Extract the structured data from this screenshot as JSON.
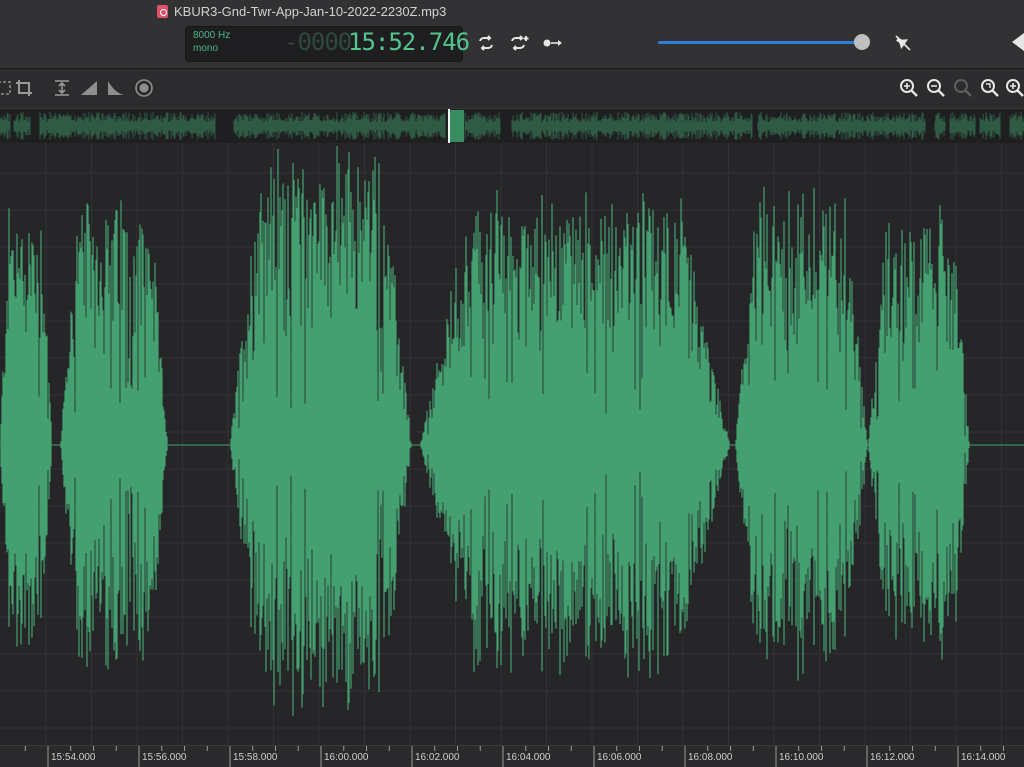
{
  "window": {
    "file_name": "KBUR3-Gnd-Twr-App-Jan-10-2022-2230Z.mp3",
    "file_icon": "audio-file-icon"
  },
  "display": {
    "sample_rate": "8000 Hz",
    "channels": "mono",
    "time_ghost": "-0000",
    "time": "15:52.746"
  },
  "transport": {
    "loop_icon": "loop-icon",
    "loop_selection_icon": "loop-selection-icon",
    "play_from_icon": "play-from-cursor-icon",
    "volume_level": 0.97,
    "volume_icon": "speaker-muted-icon",
    "back_icon": "back-arrow-icon"
  },
  "toolbar": {
    "left_tools": [
      "select-icon",
      "crop-icon",
      "normalize-icon",
      "fade-in-icon",
      "fade-out-icon",
      "effects-icon"
    ],
    "zoom_tools": [
      "zoom-in-icon",
      "zoom-out-icon",
      "zoom-selection-icon",
      "zoom-fit-icon",
      "zoom-full-icon"
    ]
  },
  "timeline": {
    "ticks": [
      "15:54.000",
      "15:56.000",
      "15:58.000",
      "16:00.000",
      "16:02.000",
      "16:04.000",
      "16:06.000",
      "16:08.000",
      "16:10.000",
      "16:12.000",
      "16:14.000"
    ]
  },
  "colors": {
    "waveform": "#44a070",
    "accent": "#2f7ed8",
    "lcd_text": "#53c58c"
  }
}
